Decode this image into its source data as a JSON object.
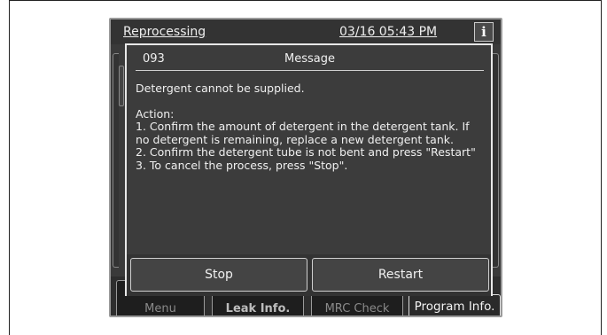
{
  "screen": {
    "title": "Reprocessing",
    "datetime": "03/16 05:43 PM",
    "info_icon": "info-icon"
  },
  "bottom_bar": {
    "menu_label": "Menu",
    "leak_label": "Leak Info.",
    "mrc_label": "MRC Check",
    "program_label": "Program Info."
  },
  "dialog": {
    "code": "093",
    "title": "Message",
    "error": "Detergent cannot be supplied.",
    "action_label": "Action:",
    "steps": [
      "1. Confirm the amount of detergent in the detergent tank. If no detergent is remaining, replace a new detergent tank.",
      "2. Confirm the detergent tube is not bent and press \"Restart\"",
      "3. To cancel the process, press \"Stop\"."
    ],
    "stop_label": "Stop",
    "restart_label": "Restart"
  }
}
